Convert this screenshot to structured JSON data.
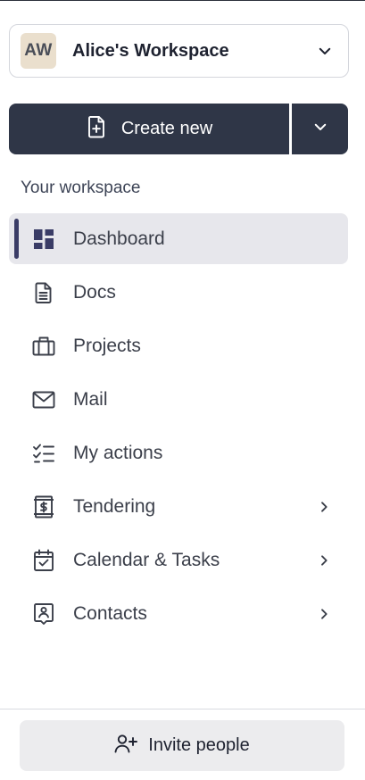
{
  "workspace": {
    "initials": "AW",
    "name": "Alice's Workspace",
    "avatar_color": "#eadfcd"
  },
  "create": {
    "label": "Create new",
    "icon": "file-plus-icon",
    "menu_icon": "chevron-down-icon",
    "color": "#2f3647"
  },
  "section": {
    "label": "Your workspace"
  },
  "nav": {
    "items": [
      {
        "label": "Dashboard",
        "icon": "dashboard-icon",
        "active": true,
        "has_submenu": false
      },
      {
        "label": "Docs",
        "icon": "document-icon",
        "active": false,
        "has_submenu": false
      },
      {
        "label": "Projects",
        "icon": "briefcase-icon",
        "active": false,
        "has_submenu": false
      },
      {
        "label": "Mail",
        "icon": "mail-icon",
        "active": false,
        "has_submenu": false
      },
      {
        "label": "My actions",
        "icon": "checklist-icon",
        "active": false,
        "has_submenu": false
      },
      {
        "label": "Tendering",
        "icon": "dollar-document-icon",
        "active": false,
        "has_submenu": true
      },
      {
        "label": "Calendar & Tasks",
        "icon": "calendar-check-icon",
        "active": false,
        "has_submenu": true
      },
      {
        "label": "Contacts",
        "icon": "contact-icon",
        "active": false,
        "has_submenu": true
      }
    ],
    "active_color": "#3a3c66"
  },
  "invite": {
    "label": "Invite people",
    "icon": "user-plus-icon"
  }
}
